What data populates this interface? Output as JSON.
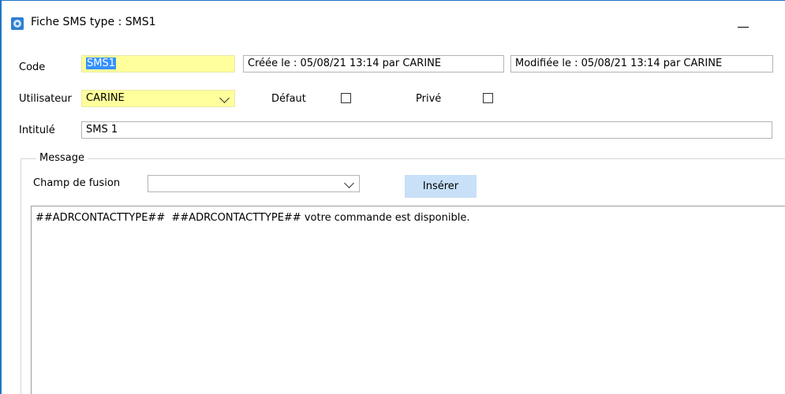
{
  "window": {
    "title": "Fiche SMS type : SMS1",
    "minimize_icon": "minimize-icon",
    "app_icon": "app-icon"
  },
  "form": {
    "code_label": "Code",
    "code_value": "SMS1",
    "created": "Créée le : 05/08/21 13:14 par CARINE",
    "modified": "Modifiée le : 05/08/21 13:14 par CARINE",
    "user_label": "Utilisateur",
    "user_value": "CARINE",
    "default_label": "Défaut",
    "default_checked": false,
    "private_label": "Privé",
    "private_checked": false,
    "title_label": "Intitulé",
    "title_value": "SMS 1"
  },
  "message": {
    "group_label": "Message",
    "merge_field_label": "Champ de fusion",
    "merge_field_value": "",
    "insert_button": "Insérer",
    "body": "##ADRCONTACTTYPE##  ##ADRCONTACTTYPE## votre commande est disponible."
  },
  "colors": {
    "required_field": "#ffff9c",
    "selection": "#3390ff",
    "button": "#c8e0f8",
    "window_border": "#1e73c8"
  }
}
